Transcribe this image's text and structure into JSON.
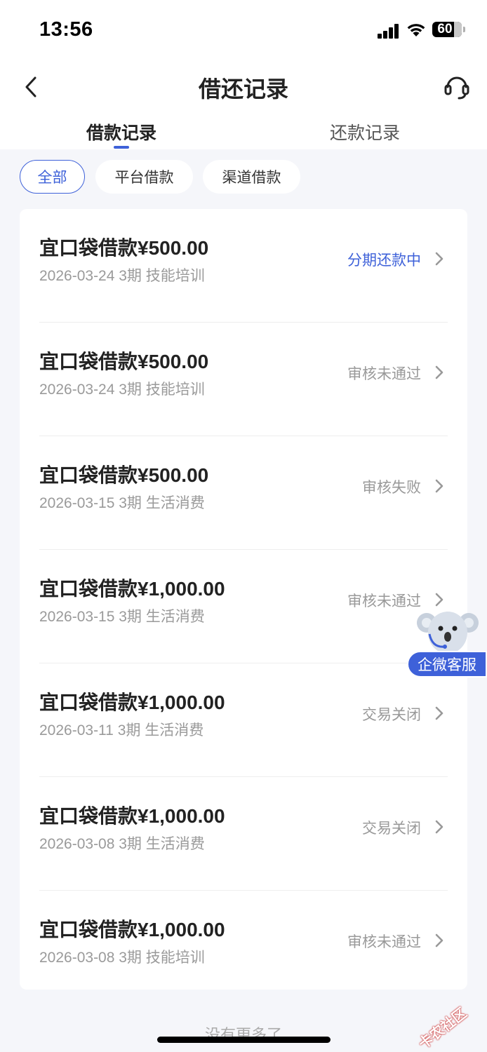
{
  "status_bar": {
    "time": "13:56",
    "battery": "60"
  },
  "navbar": {
    "title": "借还记录"
  },
  "tabs": [
    {
      "label": "借款记录",
      "active": true
    },
    {
      "label": "还款记录",
      "active": false
    }
  ],
  "filters": [
    {
      "label": "全部",
      "active": true
    },
    {
      "label": "平台借款",
      "active": false
    },
    {
      "label": "渠道借款",
      "active": false
    }
  ],
  "records": [
    {
      "title": "宜口袋借款¥500.00",
      "meta": "2026-03-24 3期  技能培训",
      "status": "分期还款中",
      "status_color": "#3e61d9"
    },
    {
      "title": "宜口袋借款¥500.00",
      "meta": "2026-03-24 3期  技能培训",
      "status": "审核未通过",
      "status_color": "#999999"
    },
    {
      "title": "宜口袋借款¥500.00",
      "meta": "2026-03-15 3期  生活消费",
      "status": "审核失败",
      "status_color": "#999999"
    },
    {
      "title": "宜口袋借款¥1,000.00",
      "meta": "2026-03-15 3期  生活消费",
      "status": "审核未通过",
      "status_color": "#999999"
    },
    {
      "title": "宜口袋借款¥1,000.00",
      "meta": "2026-03-11 3期  生活消费",
      "status": "交易关闭",
      "status_color": "#999999"
    },
    {
      "title": "宜口袋借款¥1,000.00",
      "meta": "2026-03-08 3期  生活消费",
      "status": "交易关闭",
      "status_color": "#999999"
    },
    {
      "title": "宜口袋借款¥1,000.00",
      "meta": "2026-03-08 3期  技能培训",
      "status": "审核未通过",
      "status_color": "#999999"
    }
  ],
  "float_service": {
    "label": "企微客服"
  },
  "footer": {
    "no_more": "没有更多了"
  },
  "watermark": {
    "text": "卡农社区"
  },
  "colors": {
    "accent": "#3e61d9",
    "background": "#f5f6fa"
  }
}
